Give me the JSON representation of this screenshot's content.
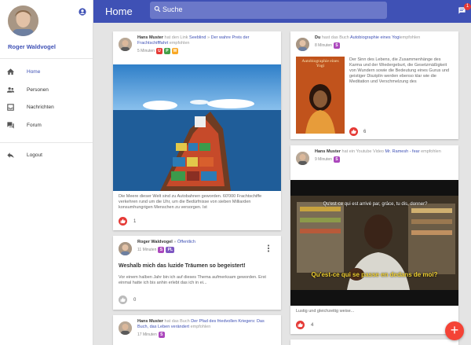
{
  "header": {
    "title": "Home",
    "search_placeholder": "Suche",
    "message_count": "1"
  },
  "sidebar": {
    "user_name": "Roger Waldvogel",
    "items": [
      {
        "label": "Home",
        "icon": "home-icon"
      },
      {
        "label": "Personen",
        "icon": "people-icon"
      },
      {
        "label": "Nachrichten",
        "icon": "inbox-icon"
      },
      {
        "label": "Forum",
        "icon": "forum-icon"
      },
      {
        "label": "Logout",
        "icon": "logout-icon"
      }
    ]
  },
  "posts": [
    {
      "author": "Hans Muster",
      "action": "hat den Link",
      "link_source": "Seeblind",
      "separator": "»",
      "link_title": "Der wahre Preis der Frachtschifffahrt",
      "suffix": "empfohlen",
      "time": "5 Minuten",
      "tags": [
        "U",
        "P",
        "W"
      ],
      "text": "Die Meere dieser Welt sind zu Autobahnen geworden. 60'000 Frachtschiffe verkehren rund um die Uhr, um die Bedürfnisse von sieben Milliarden konsumhungrigen Menschen zu versorgen. Ist",
      "likes": "1"
    },
    {
      "author": "Roger Waldvogel",
      "separator": "»",
      "visibility": "Öffentlich",
      "time": "11 Minuten",
      "tags": [
        "S",
        "PL"
      ],
      "title": "Weshalb mich das luzide Träumen so begeistert!",
      "text": "Vor einem halben Jahr bin ich auf dieses Thema aufmerksam geworden. Erst einmal hatte ich bis anhin erlebt das ich in ei...",
      "likes": "0"
    },
    {
      "author": "Hans Muster",
      "action": "hat das Buch",
      "link_title": "Der Pfad des friedvollen Kriegers: Das Buch, das Leben verändert",
      "suffix": "empfohlen",
      "time": "17 Minuten",
      "tags": [
        "S"
      ]
    },
    {
      "author": "Du",
      "action": "hast das Buch",
      "link_title": "Autobiographie eines Yogi",
      "suffix": "empfohlen",
      "time": "8 Minuten",
      "tags": [
        "S"
      ],
      "book_cover_title": "Autobiographie eines Yogi",
      "text": "Der Sinn des Lebens, die Zusammenhänge des Karma und der Wiedergeburt, die Gesetzmäßigkeit von Wundern sowie die Bedeutung eines Gurus und geistiger Disziplin werden ebenso klar wie die Meditation und Verschmelzung des",
      "likes": "6"
    },
    {
      "author": "Hans Muster",
      "action": "hat ein Youtube Video",
      "link_title": "Mr. Ramesh - fear",
      "suffix": "empfohlen",
      "time": "9 Minuten",
      "tags": [
        "S"
      ],
      "subtitle_1": "Qu'est-ce qui est arrivé par, grâce, tu dis, donner?",
      "subtitle_2": "Qu'est-ce qui se passe en dedans de moi?",
      "text": "Lustig und gleichzeitig weise...",
      "likes": "4"
    }
  ],
  "tag_colors": {
    "U": "#e53935",
    "P": "#43a047",
    "W": "#f9a825",
    "S": "#ab47bc",
    "PL": "#7e57c2"
  },
  "fab_label": "+"
}
